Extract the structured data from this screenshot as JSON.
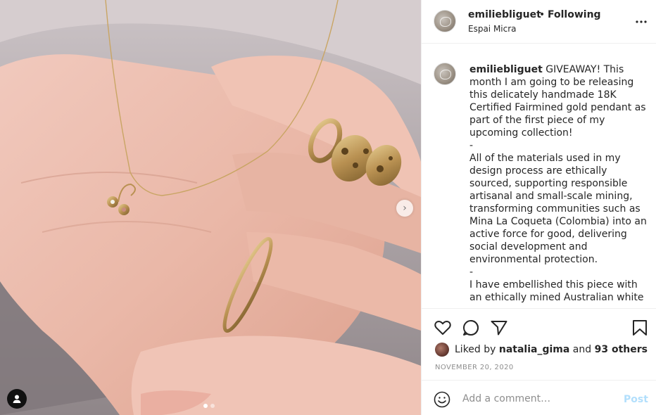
{
  "post": {
    "username": "emiliebliguet",
    "separator": "•",
    "follow_status": "Following",
    "location": "Espai Micra",
    "caption_username": "emiliebliguet",
    "caption_text": " GIVEAWAY! This month I am going to be releasing this delicately handmade 18K Certified Fairmined gold pendant as part of the first piece of my upcoming collection!\n-\nAll of the materials used in my design process are ethically sourced, supporting responsible artisanal and small-scale mining, transforming communities such as Mina La Coqueta (Colombia) into an active force for good, delivering social development and environmental protection.\n-\nI have embellished this piece with an ethically mined Australian white"
  },
  "carousel": {
    "next_arrow": "›",
    "slide_count": 2,
    "active_slide": 1
  },
  "likes": {
    "prefix": "Liked by ",
    "liker": "natalia_gima",
    "joiner": " and ",
    "others": "93 others"
  },
  "date": "NOVEMBER 20, 2020",
  "comment": {
    "placeholder": "Add a comment…",
    "post_label": "Post"
  },
  "icons": {
    "more": "more-options-icon",
    "like": "heart-icon",
    "comment": "comment-bubble-icon",
    "share": "paper-plane-icon",
    "save": "bookmark-icon",
    "emoji": "emoji-icon",
    "tags": "user-tag-icon"
  },
  "colors": {
    "accent_post_disabled": "#b2dffc",
    "text": "#262626",
    "muted": "#8e8e8e",
    "divider": "#efefef"
  }
}
